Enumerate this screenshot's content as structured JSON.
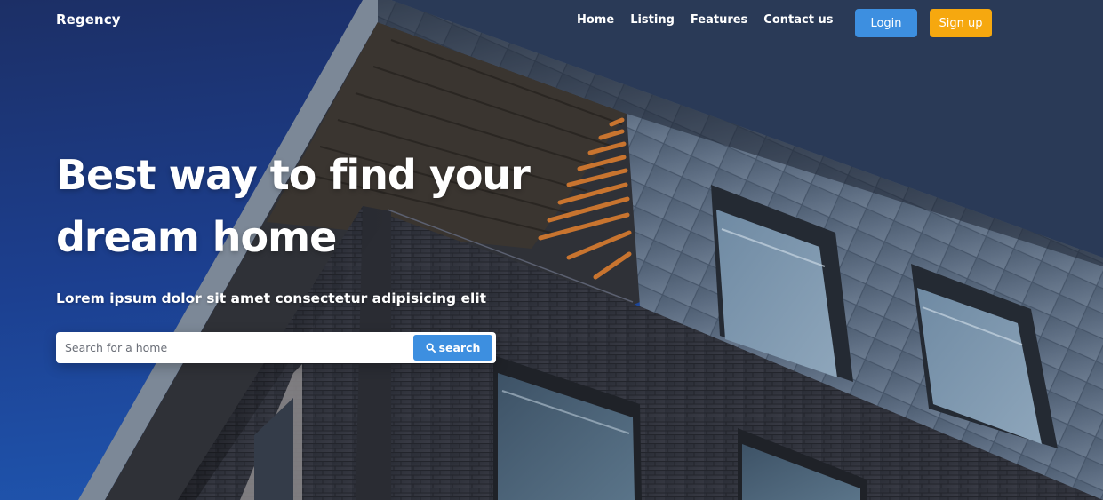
{
  "brand": {
    "name": "Regency"
  },
  "nav": {
    "links": [
      {
        "label": "Home"
      },
      {
        "label": "Listing"
      },
      {
        "label": "Features"
      },
      {
        "label": "Contact us"
      }
    ],
    "login_label": "Login",
    "signup_label": "Sign up"
  },
  "hero": {
    "headline_line1": "Best way to find your",
    "headline_line2": "dream home",
    "subtitle": "Lorem ipsum dolor sit amet consectetur adipisicing elit",
    "search": {
      "placeholder": "Search for a home",
      "value": "",
      "button_label": "search",
      "icon": "search-icon"
    }
  },
  "colors": {
    "sky_top": "#1c2f66",
    "sky_bottom": "#1d4fa8",
    "login_button": "#3d8fe0",
    "signup_button": "#f6a80f",
    "search_button": "#3d8fe0"
  }
}
